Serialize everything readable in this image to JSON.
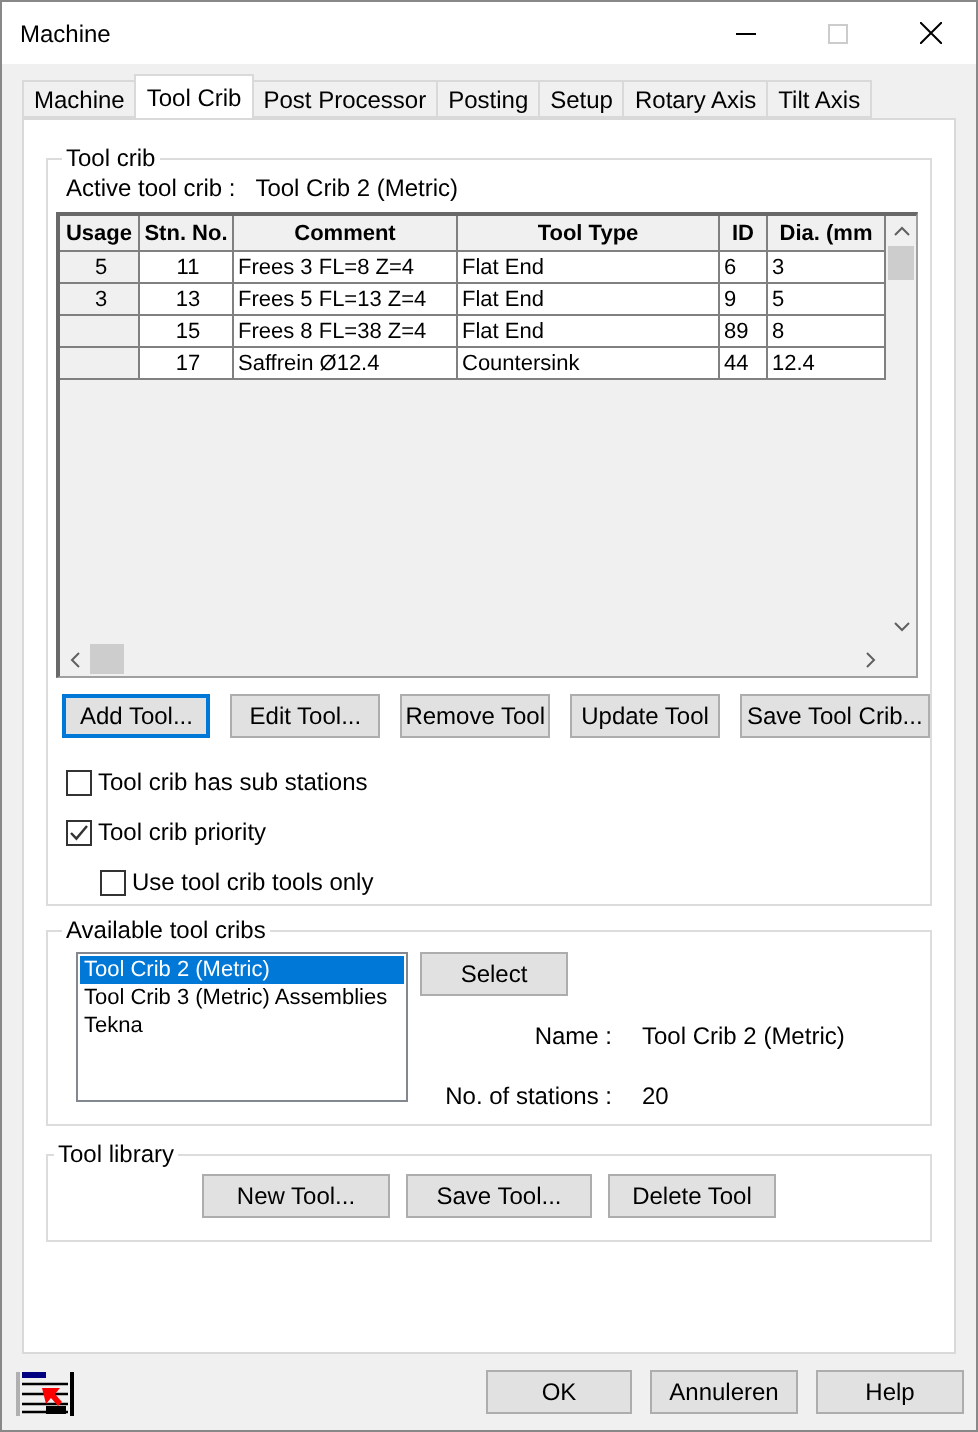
{
  "window": {
    "title": "Machine"
  },
  "tabs": [
    {
      "label": "Machine",
      "selected": false
    },
    {
      "label": "Tool Crib",
      "selected": true
    },
    {
      "label": "Post Processor",
      "selected": false
    },
    {
      "label": "Posting",
      "selected": false
    },
    {
      "label": "Setup",
      "selected": false
    },
    {
      "label": "Rotary Axis",
      "selected": false
    },
    {
      "label": "Tilt Axis",
      "selected": false
    }
  ],
  "tool_crib": {
    "title": "Tool crib",
    "active_label": "Active tool crib :",
    "active_value": "Tool Crib 2 (Metric)",
    "table": {
      "columns": [
        "Usage",
        "Stn. No.",
        "Comment",
        "Tool Type",
        "ID",
        "Dia. (mm"
      ],
      "rows": [
        {
          "cells": [
            "5",
            "11",
            "Frees 3 FL=8 Z=4",
            "Flat End",
            "6",
            "3"
          ]
        },
        {
          "cells": [
            "3",
            "13",
            "Frees 5 FL=13 Z=4",
            "Flat End",
            "9",
            "5"
          ]
        },
        {
          "cells": [
            "",
            "15",
            "Frees 8 FL=38 Z=4",
            "Flat End",
            "89",
            "8"
          ]
        },
        {
          "cells": [
            "",
            "17",
            "Saffrein Ø12.4",
            "Countersink",
            "44",
            "12.4"
          ]
        }
      ]
    },
    "buttons": [
      {
        "label": "Add Tool...",
        "focused": true
      },
      {
        "label": "Edit Tool...",
        "focused": false
      },
      {
        "label": "Remove Tool",
        "focused": false
      },
      {
        "label": "Update Tool",
        "focused": false
      },
      {
        "label": "Save Tool Crib...",
        "focused": false
      }
    ],
    "options": [
      {
        "label": "Tool crib has sub stations",
        "checked": false
      },
      {
        "label": "Tool crib priority",
        "checked": true,
        "children": [
          {
            "label": "Use tool crib tools only",
            "checked": false
          }
        ]
      }
    ]
  },
  "available": {
    "title": "Available tool cribs",
    "items": [
      {
        "label": "Tool Crib 2 (Metric)",
        "selected": true
      },
      {
        "label": "Tool Crib 3 (Metric) Assemblies",
        "selected": false
      },
      {
        "label": "Tekna",
        "selected": false
      }
    ],
    "select_button": "Select",
    "name_label": "Name :",
    "name_value": "Tool Crib 2 (Metric)",
    "stations_label": "No. of stations :",
    "stations_value": "20"
  },
  "library": {
    "title": "Tool library",
    "buttons": [
      "New Tool...",
      "Save Tool...",
      "Delete Tool"
    ]
  },
  "footer_buttons": [
    "OK",
    "Annuleren",
    "Help"
  ]
}
